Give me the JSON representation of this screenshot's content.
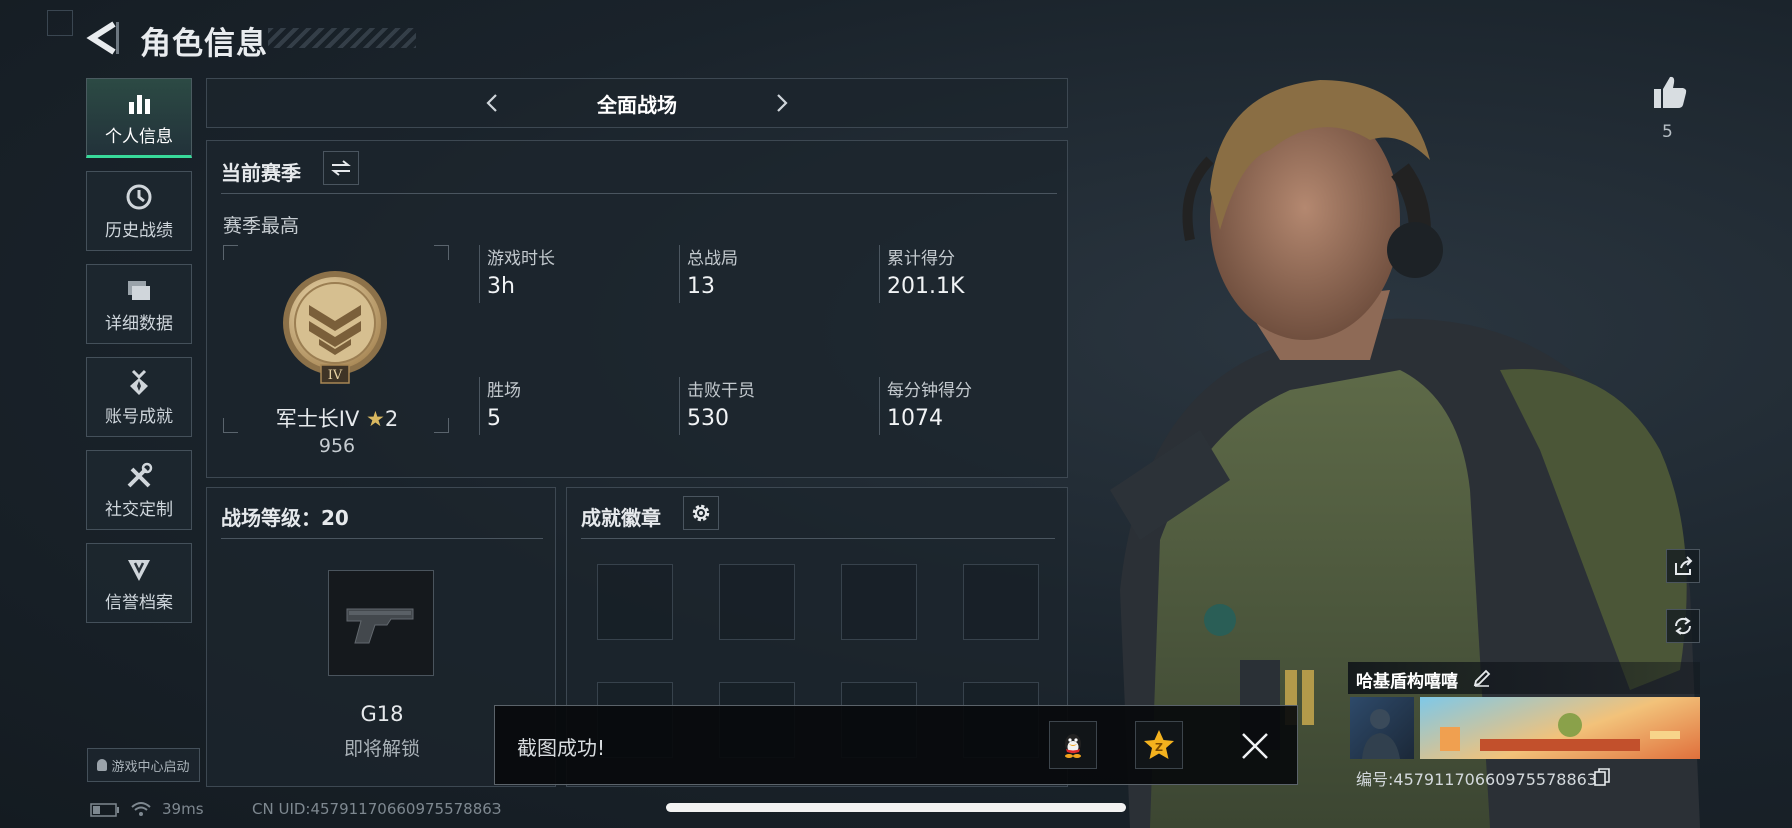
{
  "header": {
    "title": "角色信息"
  },
  "sidebar": {
    "items": [
      {
        "label": "个人信息",
        "icon": "bar-chart-icon",
        "active": true
      },
      {
        "label": "历史战绩",
        "icon": "clock-history-icon"
      },
      {
        "label": "详细数据",
        "icon": "folder-stack-icon"
      },
      {
        "label": "账号成就",
        "icon": "medal-icon"
      },
      {
        "label": "社交定制",
        "icon": "tools-icon"
      },
      {
        "label": "信誉档案",
        "icon": "shield-diamond-icon"
      }
    ],
    "launch_label": "游戏中心启动"
  },
  "mode": {
    "title": "全面战场"
  },
  "season": {
    "title": "当前赛季",
    "subtitle": "赛季最高",
    "rank_name": "军士长IV",
    "rank_stars": "2",
    "rank_points": "956",
    "rank_numeral": "IV",
    "stats": [
      {
        "label": "游戏时长",
        "value": "3h"
      },
      {
        "label": "总战局",
        "value": "13"
      },
      {
        "label": "累计得分",
        "value": "201.1K"
      },
      {
        "label": "胜场",
        "value": "5"
      },
      {
        "label": "击败干员",
        "value": "530"
      },
      {
        "label": "每分钟得分",
        "value": "1074"
      }
    ]
  },
  "level": {
    "title": "战场等级：20",
    "weapon_name": "G18",
    "weapon_status": "即将解锁"
  },
  "badges": {
    "title": "成就徽章"
  },
  "toast": {
    "text": "截图成功!"
  },
  "status_bar": {
    "ping": "39ms",
    "uid": "CN UID:4579117066097557886З"
  },
  "profile": {
    "likes": "5",
    "player_name": "哈基盾构嘻嘻",
    "player_id": "编号:45791170660975578863"
  },
  "colors": {
    "accent": "#38d99a",
    "panel_border": "#3d4852",
    "background": "#1a232b"
  }
}
